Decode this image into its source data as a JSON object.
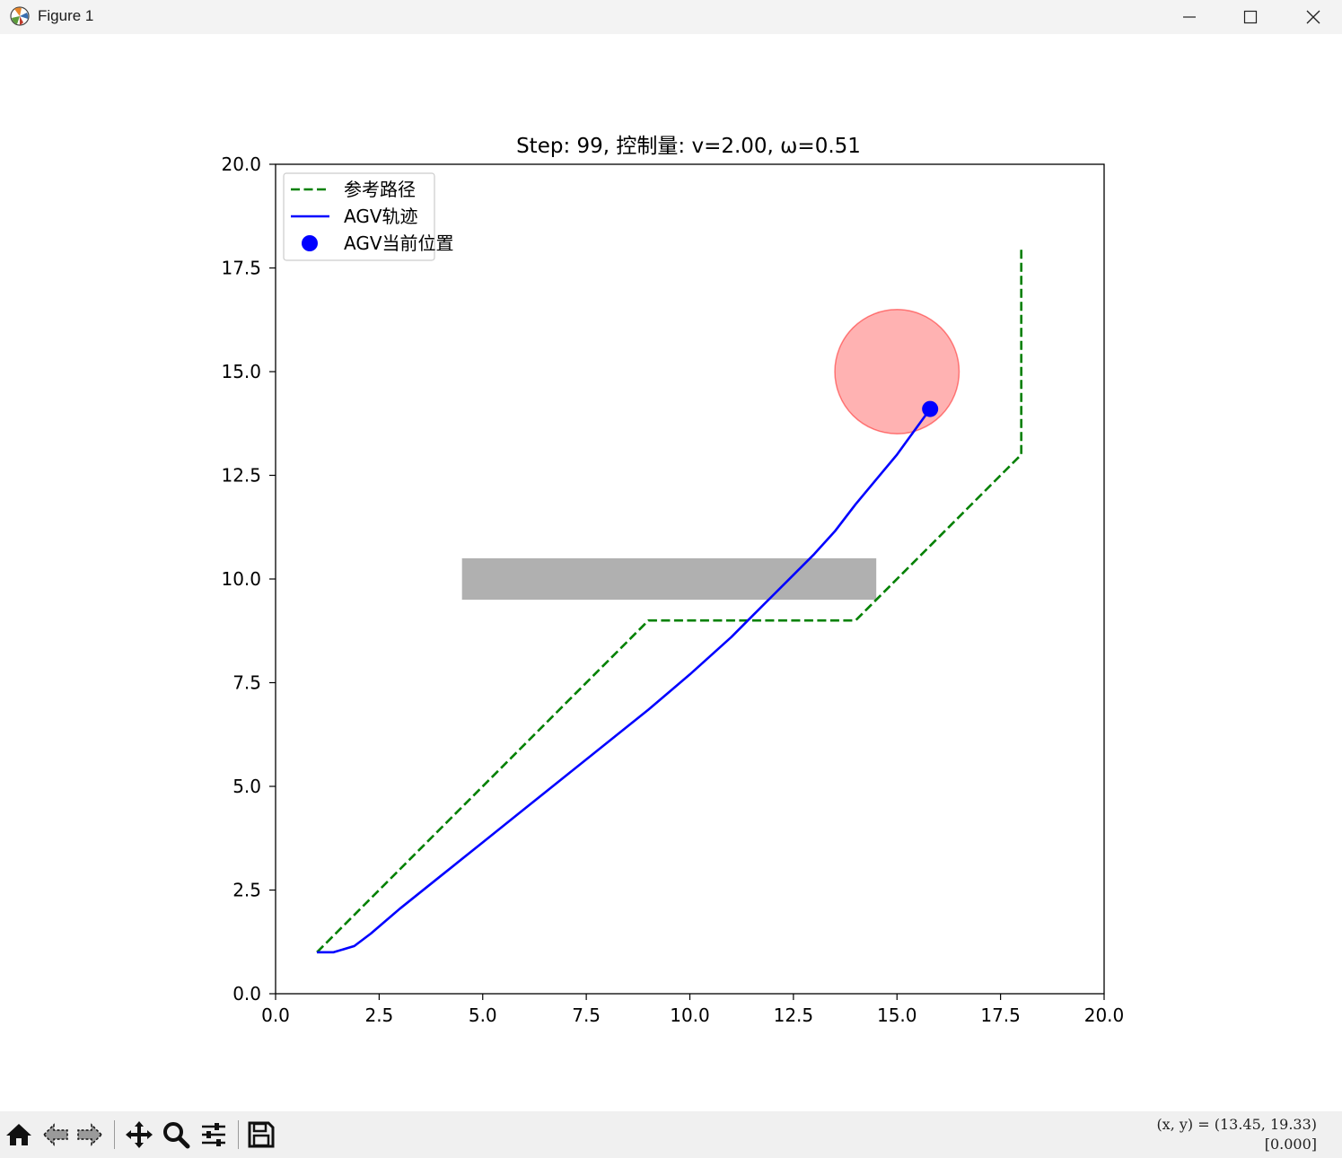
{
  "window": {
    "title": "Figure 1",
    "icons": {
      "app": "matplotlib-icon",
      "minimize": "minimize-icon",
      "maximize": "maximize-icon",
      "close": "close-icon"
    }
  },
  "figure": {
    "title": "Step: 99, 控制量: v=2.00, ω=0.51"
  },
  "chart_data": {
    "type": "line",
    "title": "Step: 99, 控制量: v=2.00, ω=0.51",
    "xlabel": "",
    "ylabel": "",
    "xlim": [
      0,
      20
    ],
    "ylim": [
      0,
      20
    ],
    "xticks": [
      "0.0",
      "2.5",
      "5.0",
      "7.5",
      "10.0",
      "12.5",
      "15.0",
      "17.5",
      "20.0"
    ],
    "yticks": [
      "0.0",
      "2.5",
      "5.0",
      "7.5",
      "10.0",
      "12.5",
      "15.0",
      "17.5",
      "20.0"
    ],
    "grid": false,
    "legend_position": "upper-left",
    "series": [
      {
        "name": "参考路径",
        "style": "dashed",
        "color": "#008000",
        "x": [
          1,
          9,
          14,
          18,
          18
        ],
        "y": [
          1,
          9,
          9,
          13,
          18
        ]
      },
      {
        "name": "AGV轨迹",
        "style": "solid",
        "color": "#0000ff",
        "x": [
          1.0,
          1.4,
          1.9,
          2.3,
          3.0,
          4.0,
          5.0,
          6.0,
          7.0,
          8.0,
          9.0,
          10.0,
          11.0,
          11.5,
          12.0,
          12.5,
          13.0,
          13.5,
          14.0,
          14.5,
          15.0,
          15.4,
          15.8
        ],
        "y": [
          1.0,
          1.0,
          1.15,
          1.45,
          2.05,
          2.85,
          3.65,
          4.45,
          5.25,
          6.05,
          6.85,
          7.7,
          8.6,
          9.1,
          9.6,
          10.1,
          10.6,
          11.15,
          11.8,
          12.4,
          13.0,
          13.55,
          14.1
        ]
      },
      {
        "name": "AGV当前位置",
        "style": "marker",
        "color": "#0000ff",
        "x": [
          15.8
        ],
        "y": [
          14.1
        ]
      }
    ],
    "obstacles": [
      {
        "type": "rectangle",
        "x": 4.5,
        "y": 9.5,
        "width": 10,
        "height": 1,
        "color": "#b0b0b0"
      },
      {
        "type": "circle",
        "cx": 15,
        "cy": 15,
        "r": 1.5,
        "color": "#ff0000",
        "alpha": 0.3
      }
    ]
  },
  "toolbar": {
    "icons": [
      "home-icon",
      "back-icon",
      "forward-icon",
      "pan-icon",
      "zoom-icon",
      "configure-subplots-icon",
      "save-icon"
    ],
    "coords_line1": "(x, y) = (13.45, 19.33)",
    "coords_line2": "[0.000]"
  }
}
